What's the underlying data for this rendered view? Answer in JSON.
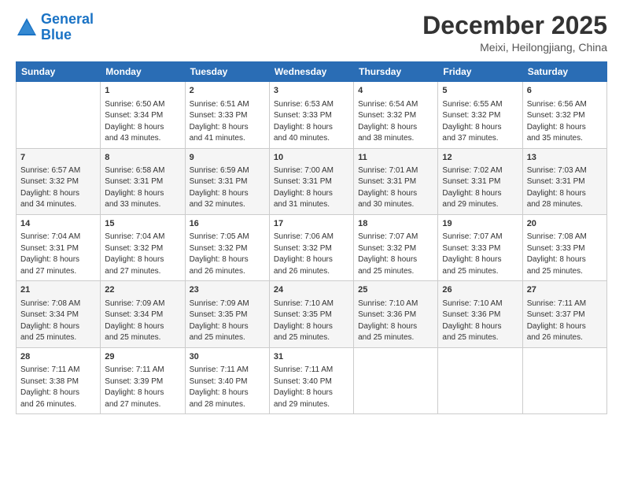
{
  "logo": {
    "line1": "General",
    "line2": "Blue"
  },
  "title": "December 2025",
  "subtitle": "Meixi, Heilongjiang, China",
  "days_of_week": [
    "Sunday",
    "Monday",
    "Tuesday",
    "Wednesday",
    "Thursday",
    "Friday",
    "Saturday"
  ],
  "weeks": [
    [
      {
        "day": "",
        "info": ""
      },
      {
        "day": "1",
        "info": "Sunrise: 6:50 AM\nSunset: 3:34 PM\nDaylight: 8 hours\nand 43 minutes."
      },
      {
        "day": "2",
        "info": "Sunrise: 6:51 AM\nSunset: 3:33 PM\nDaylight: 8 hours\nand 41 minutes."
      },
      {
        "day": "3",
        "info": "Sunrise: 6:53 AM\nSunset: 3:33 PM\nDaylight: 8 hours\nand 40 minutes."
      },
      {
        "day": "4",
        "info": "Sunrise: 6:54 AM\nSunset: 3:32 PM\nDaylight: 8 hours\nand 38 minutes."
      },
      {
        "day": "5",
        "info": "Sunrise: 6:55 AM\nSunset: 3:32 PM\nDaylight: 8 hours\nand 37 minutes."
      },
      {
        "day": "6",
        "info": "Sunrise: 6:56 AM\nSunset: 3:32 PM\nDaylight: 8 hours\nand 35 minutes."
      }
    ],
    [
      {
        "day": "7",
        "info": "Sunrise: 6:57 AM\nSunset: 3:32 PM\nDaylight: 8 hours\nand 34 minutes."
      },
      {
        "day": "8",
        "info": "Sunrise: 6:58 AM\nSunset: 3:31 PM\nDaylight: 8 hours\nand 33 minutes."
      },
      {
        "day": "9",
        "info": "Sunrise: 6:59 AM\nSunset: 3:31 PM\nDaylight: 8 hours\nand 32 minutes."
      },
      {
        "day": "10",
        "info": "Sunrise: 7:00 AM\nSunset: 3:31 PM\nDaylight: 8 hours\nand 31 minutes."
      },
      {
        "day": "11",
        "info": "Sunrise: 7:01 AM\nSunset: 3:31 PM\nDaylight: 8 hours\nand 30 minutes."
      },
      {
        "day": "12",
        "info": "Sunrise: 7:02 AM\nSunset: 3:31 PM\nDaylight: 8 hours\nand 29 minutes."
      },
      {
        "day": "13",
        "info": "Sunrise: 7:03 AM\nSunset: 3:31 PM\nDaylight: 8 hours\nand 28 minutes."
      }
    ],
    [
      {
        "day": "14",
        "info": "Sunrise: 7:04 AM\nSunset: 3:31 PM\nDaylight: 8 hours\nand 27 minutes."
      },
      {
        "day": "15",
        "info": "Sunrise: 7:04 AM\nSunset: 3:32 PM\nDaylight: 8 hours\nand 27 minutes."
      },
      {
        "day": "16",
        "info": "Sunrise: 7:05 AM\nSunset: 3:32 PM\nDaylight: 8 hours\nand 26 minutes."
      },
      {
        "day": "17",
        "info": "Sunrise: 7:06 AM\nSunset: 3:32 PM\nDaylight: 8 hours\nand 26 minutes."
      },
      {
        "day": "18",
        "info": "Sunrise: 7:07 AM\nSunset: 3:32 PM\nDaylight: 8 hours\nand 25 minutes."
      },
      {
        "day": "19",
        "info": "Sunrise: 7:07 AM\nSunset: 3:33 PM\nDaylight: 8 hours\nand 25 minutes."
      },
      {
        "day": "20",
        "info": "Sunrise: 7:08 AM\nSunset: 3:33 PM\nDaylight: 8 hours\nand 25 minutes."
      }
    ],
    [
      {
        "day": "21",
        "info": "Sunrise: 7:08 AM\nSunset: 3:34 PM\nDaylight: 8 hours\nand 25 minutes."
      },
      {
        "day": "22",
        "info": "Sunrise: 7:09 AM\nSunset: 3:34 PM\nDaylight: 8 hours\nand 25 minutes."
      },
      {
        "day": "23",
        "info": "Sunrise: 7:09 AM\nSunset: 3:35 PM\nDaylight: 8 hours\nand 25 minutes."
      },
      {
        "day": "24",
        "info": "Sunrise: 7:10 AM\nSunset: 3:35 PM\nDaylight: 8 hours\nand 25 minutes."
      },
      {
        "day": "25",
        "info": "Sunrise: 7:10 AM\nSunset: 3:36 PM\nDaylight: 8 hours\nand 25 minutes."
      },
      {
        "day": "26",
        "info": "Sunrise: 7:10 AM\nSunset: 3:36 PM\nDaylight: 8 hours\nand 25 minutes."
      },
      {
        "day": "27",
        "info": "Sunrise: 7:11 AM\nSunset: 3:37 PM\nDaylight: 8 hours\nand 26 minutes."
      }
    ],
    [
      {
        "day": "28",
        "info": "Sunrise: 7:11 AM\nSunset: 3:38 PM\nDaylight: 8 hours\nand 26 minutes."
      },
      {
        "day": "29",
        "info": "Sunrise: 7:11 AM\nSunset: 3:39 PM\nDaylight: 8 hours\nand 27 minutes."
      },
      {
        "day": "30",
        "info": "Sunrise: 7:11 AM\nSunset: 3:40 PM\nDaylight: 8 hours\nand 28 minutes."
      },
      {
        "day": "31",
        "info": "Sunrise: 7:11 AM\nSunset: 3:40 PM\nDaylight: 8 hours\nand 29 minutes."
      },
      {
        "day": "",
        "info": ""
      },
      {
        "day": "",
        "info": ""
      },
      {
        "day": "",
        "info": ""
      }
    ]
  ]
}
